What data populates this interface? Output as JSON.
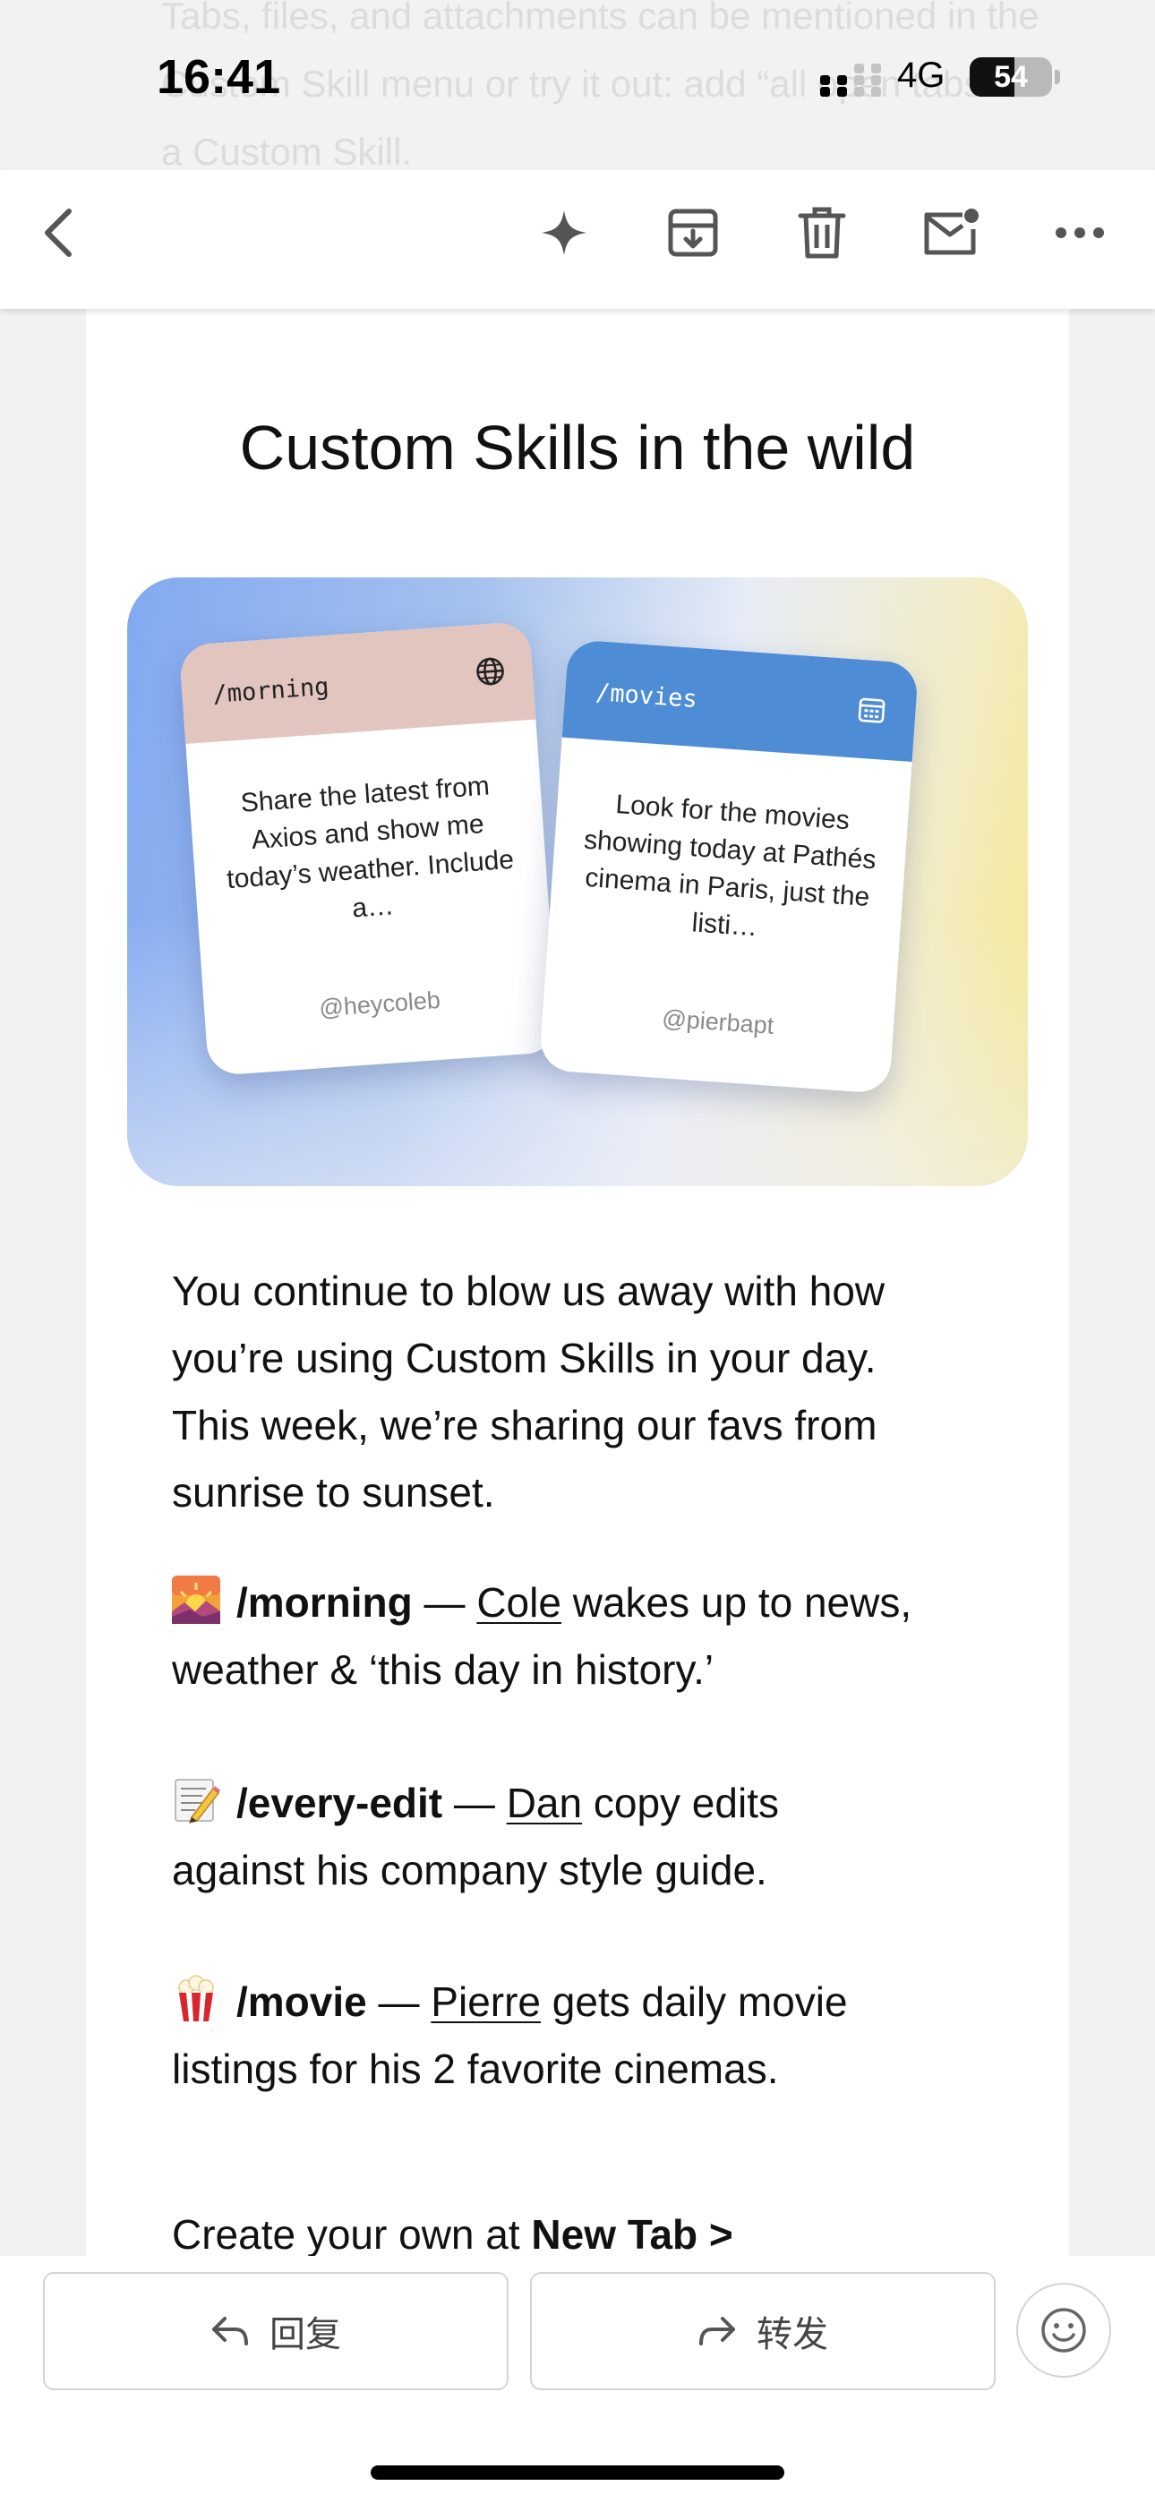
{
  "faded_text": "Tabs, files, and attachments can be mentioned in the Custom Skill menu or try it out: add “all open tabs” to a Custom Skill.",
  "status_bar": {
    "time": "16:41",
    "network": "4G",
    "battery_level": 54,
    "battery_label": "54"
  },
  "toolbar": {
    "back_icon": "chevron-left-icon",
    "icons": [
      "sparkle-icon",
      "archive-icon",
      "trash-icon",
      "mark-unread-icon",
      "more-icon"
    ]
  },
  "content": {
    "headline": "Custom Skills in the wild",
    "hero": {
      "colors": {
        "morning_header": "#e3c5c0",
        "movies_header": "#4e8dd6"
      },
      "cards": [
        {
          "command": "/morning",
          "icon": "globe-icon",
          "body": "Share the latest from Axios and show me today’s weather. Include a…",
          "handle": "@heycoleb"
        },
        {
          "command": "/movies",
          "icon": "calendar-icon",
          "body": "Look for the movies showing today at Pathés cinema in Paris, just the listi…",
          "handle": "@pierbapt"
        }
      ]
    },
    "intro": [
      "You continue to blow us away with how",
      "you’re using Custom Skills in your day.",
      "This week, we’re sharing our favs from",
      "sunrise to sunset."
    ],
    "skills": [
      {
        "emoji_icon": "sunrise-icon",
        "command": "/morning",
        "dash": " — ",
        "user": "Cole",
        "text_line1": " wakes up to news,",
        "text_line2": "weather & ‘this day in history.’"
      },
      {
        "emoji_icon": "memo-icon",
        "command": "/every-edit",
        "dash": " — ",
        "user": "Dan",
        "text_line1": " copy edits",
        "text_line2": "against his company style guide."
      },
      {
        "emoji_icon": "popcorn-icon",
        "command": "/movie",
        "dash": " — ",
        "user": "Pierre",
        "text_line1": " gets daily movie",
        "text_line2": "listings for his 2 favorite cinemas."
      }
    ],
    "cta_prefix": "Create your own at ",
    "cta_link": "New Tab >"
  },
  "bottom_bar": {
    "reply_label": "回复",
    "forward_label": "转发"
  }
}
